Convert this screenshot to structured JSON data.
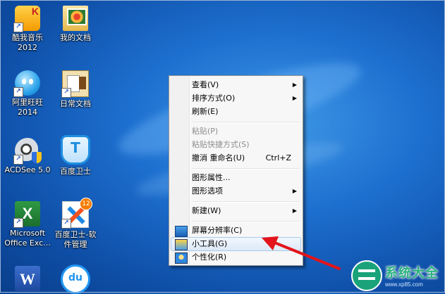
{
  "desktop": {
    "icons": [
      {
        "label": "酷我音乐\n2012",
        "glyph": "K"
      },
      {
        "label": "我的文档"
      },
      {
        "label": "阿里旺旺\n2014"
      },
      {
        "label": "日常文档"
      },
      {
        "label": "ACDSee 5.0"
      },
      {
        "label": "百度卫士",
        "glyph": "T"
      },
      {
        "label": "Microsoft\nOffice Exc...",
        "glyph": "X"
      },
      {
        "label": "百度卫士-软\n件管理",
        "badge": "12"
      },
      {
        "label": "",
        "glyph": "W"
      },
      {
        "label": "",
        "glyph": "du"
      }
    ]
  },
  "context_menu": {
    "items": [
      {
        "label": "查看(V)",
        "submenu": true
      },
      {
        "label": "排序方式(O)",
        "submenu": true
      },
      {
        "label": "刷新(E)"
      },
      {
        "label": "粘贴(P)",
        "disabled": true
      },
      {
        "label": "粘贴快捷方式(S)",
        "disabled": true
      },
      {
        "label": "撤消 重命名(U)",
        "shortcut": "Ctrl+Z"
      },
      {
        "label": "图形属性..."
      },
      {
        "label": "图形选项",
        "submenu": true
      },
      {
        "label": "新建(W)",
        "submenu": true
      },
      {
        "label": "屏幕分辨率(C)",
        "icon": "screen-resolution-icon"
      },
      {
        "label": "小工具(G)",
        "icon": "gadgets-icon",
        "highlighted": true
      },
      {
        "label": "个性化(R)",
        "icon": "personalize-icon"
      }
    ],
    "submenu_glyph": "▶"
  },
  "watermark": {
    "title": "系统大全",
    "url": "www.xp85.com"
  },
  "colors": {
    "desktop": "#1d6fcf",
    "arrow": "#e3141b",
    "watermark": "#2db37e"
  }
}
